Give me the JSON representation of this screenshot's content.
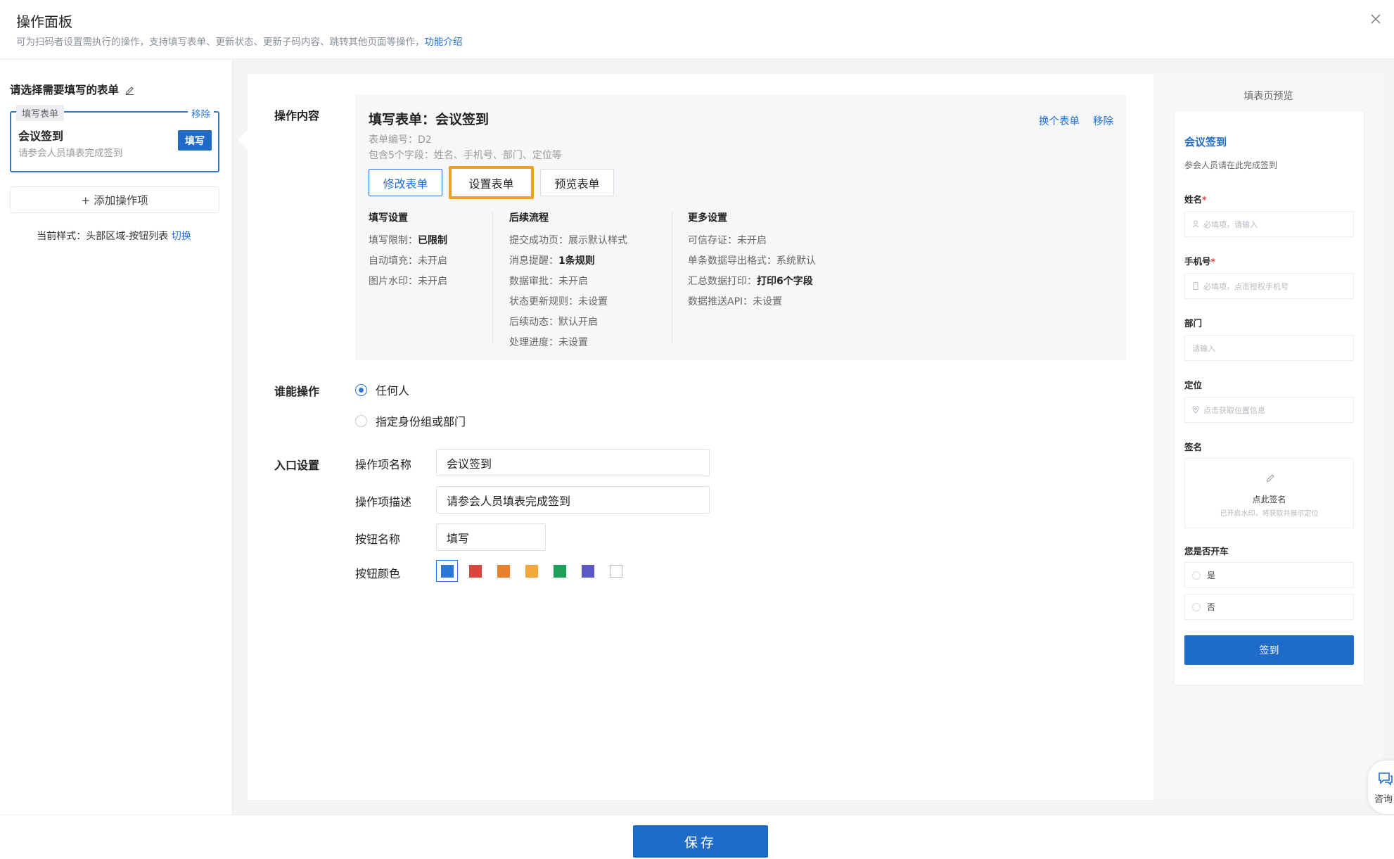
{
  "header": {
    "title": "操作面板",
    "description": "可为扫码者设置需执行的操作，支持填写表单、更新状态、更新子码内容、跳转其他页面等操作，",
    "link": "功能介绍"
  },
  "left": {
    "heading": "请选择需要填写的表单",
    "card": {
      "tag": "填写表单",
      "remove": "移除",
      "name": "会议签到",
      "subtitle": "请参会人员填表完成签到",
      "button": "填写"
    },
    "add_item": "+ 添加操作项",
    "style_text": "当前样式：头部区域-按钮列表",
    "style_switch": "切换"
  },
  "main": {
    "section_content": "操作内容",
    "form": {
      "title": "填写表单：会议签到",
      "number": "表单编号：D2",
      "fields": "包含5个字段：姓名、手机号、部门、定位等",
      "change": "换个表单",
      "remove": "移除",
      "btn_edit": "修改表单",
      "btn_settings": "设置表单",
      "btn_preview": "预览表单"
    },
    "col_fill": {
      "title": "填写设置",
      "rows": [
        {
          "label": "填写限制：",
          "value": "已限制"
        },
        {
          "label": "自动填充：",
          "value": "未开启"
        },
        {
          "label": "图片水印：",
          "value": "未开启"
        }
      ]
    },
    "col_flow": {
      "title": "后续流程",
      "rows": [
        {
          "label": "提交成功页：",
          "value": "展示默认样式"
        },
        {
          "label": "消息提醒：",
          "value": "1条规则"
        },
        {
          "label": "数据审批：",
          "value": "未开启"
        },
        {
          "label": "状态更新规则：",
          "value": "未设置"
        },
        {
          "label": "后续动态：",
          "value": "默认开启"
        },
        {
          "label": "处理进度：",
          "value": "未设置"
        }
      ]
    },
    "col_more": {
      "title": "更多设置",
      "rows": [
        {
          "label": "可信存证：",
          "value": "未开启"
        },
        {
          "label": "单条数据导出格式：",
          "value": "系统默认"
        },
        {
          "label": "汇总数据打印：",
          "value": "打印6个字段"
        },
        {
          "label": "数据推送API：",
          "value": "未设置"
        }
      ]
    },
    "section_who": "谁能操作",
    "who_options": [
      "任何人",
      "指定身份组或部门"
    ],
    "section_entry": "入口设置",
    "entry": {
      "name_label": "操作项名称",
      "name_value": "会议签到",
      "desc_label": "操作项描述",
      "desc_value": "请参会人员填表完成签到",
      "btn_label": "按钮名称",
      "btn_value": "填写",
      "color_label": "按钮颜色",
      "colors": [
        "#2b77d8",
        "#d9453d",
        "#e8812c",
        "#f0a83a",
        "#21a05a",
        "#5a58c9",
        "#ffffff"
      ],
      "selected_color": "#2b77d8"
    }
  },
  "preview": {
    "title": "填表页预览",
    "form_name": "会议签到",
    "form_desc": "参会人员请在此完成签到",
    "fields": {
      "name_label": "姓名",
      "name_ph": "必填项，请输入",
      "phone_label": "手机号",
      "phone_ph": "必填项，点击授权手机号",
      "dept_label": "部门",
      "dept_ph": "请输入",
      "loc_label": "定位",
      "loc_ph": "点击获取位置信息",
      "sign_label": "签名",
      "sign_text": "点此签名",
      "sign_hint": "已开启水印，将获取并展示定位",
      "car_label": "您是否开车",
      "car_options": [
        "是",
        "否"
      ]
    },
    "submit": "签到"
  },
  "consult": "咨询",
  "footer": {
    "save": "保存"
  }
}
